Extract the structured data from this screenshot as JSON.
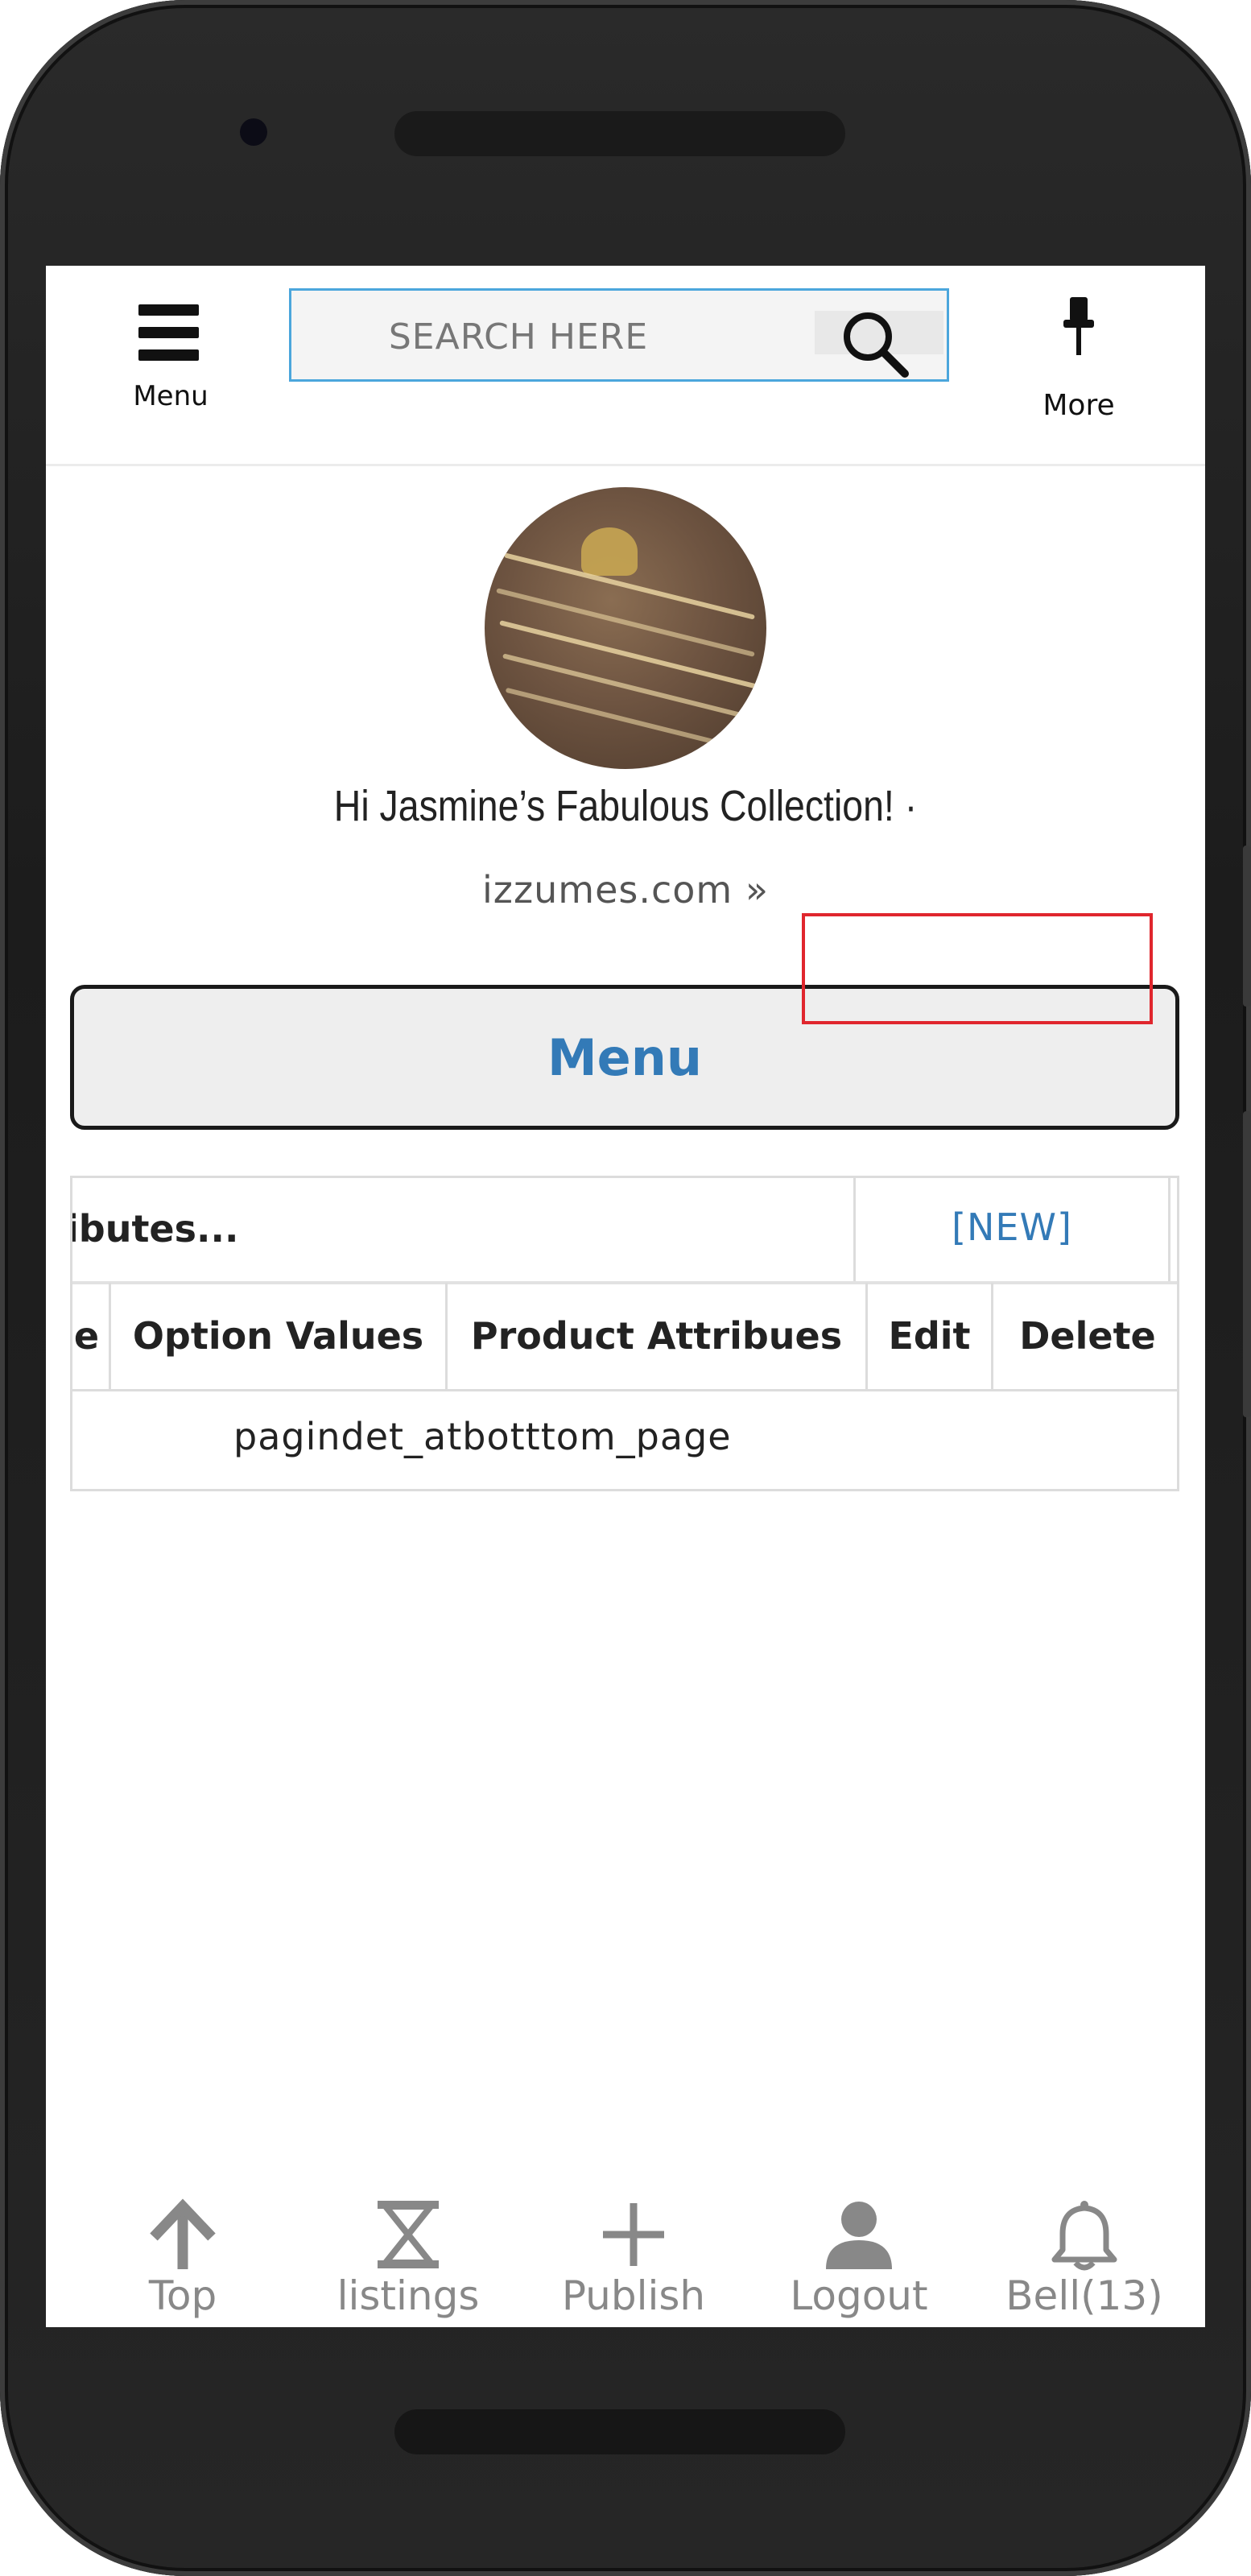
{
  "header": {
    "menu_label": "Menu",
    "search_placeholder": "SEARCH HERE",
    "more_label": "More"
  },
  "profile": {
    "greeting": "Hi Jasmine’s Fabulous Collection! ·",
    "site_link": "izzumes.com »"
  },
  "menu_button_label": "Menu",
  "table": {
    "title": "ibutes...",
    "new_label": "[NEW]",
    "columns": [
      "e",
      "Option Values",
      "Product Attribues",
      "Edit",
      "Delete"
    ],
    "rows": [
      [
        "pagindet_atbotttom_page"
      ]
    ]
  },
  "bottom_nav": {
    "items": [
      {
        "label": "Top",
        "icon": "arrow-up-icon"
      },
      {
        "label": "listings",
        "icon": "hourglass-icon"
      },
      {
        "label": "Publish",
        "icon": "plus-icon"
      },
      {
        "label": "Logout",
        "icon": "user-icon"
      },
      {
        "label": "Bell(13)",
        "icon": "bell-icon"
      }
    ]
  },
  "colors": {
    "link_blue": "#337ab7",
    "search_border": "#4ba6dc",
    "highlight_red": "#e0262d",
    "nav_gray": "#888888"
  }
}
